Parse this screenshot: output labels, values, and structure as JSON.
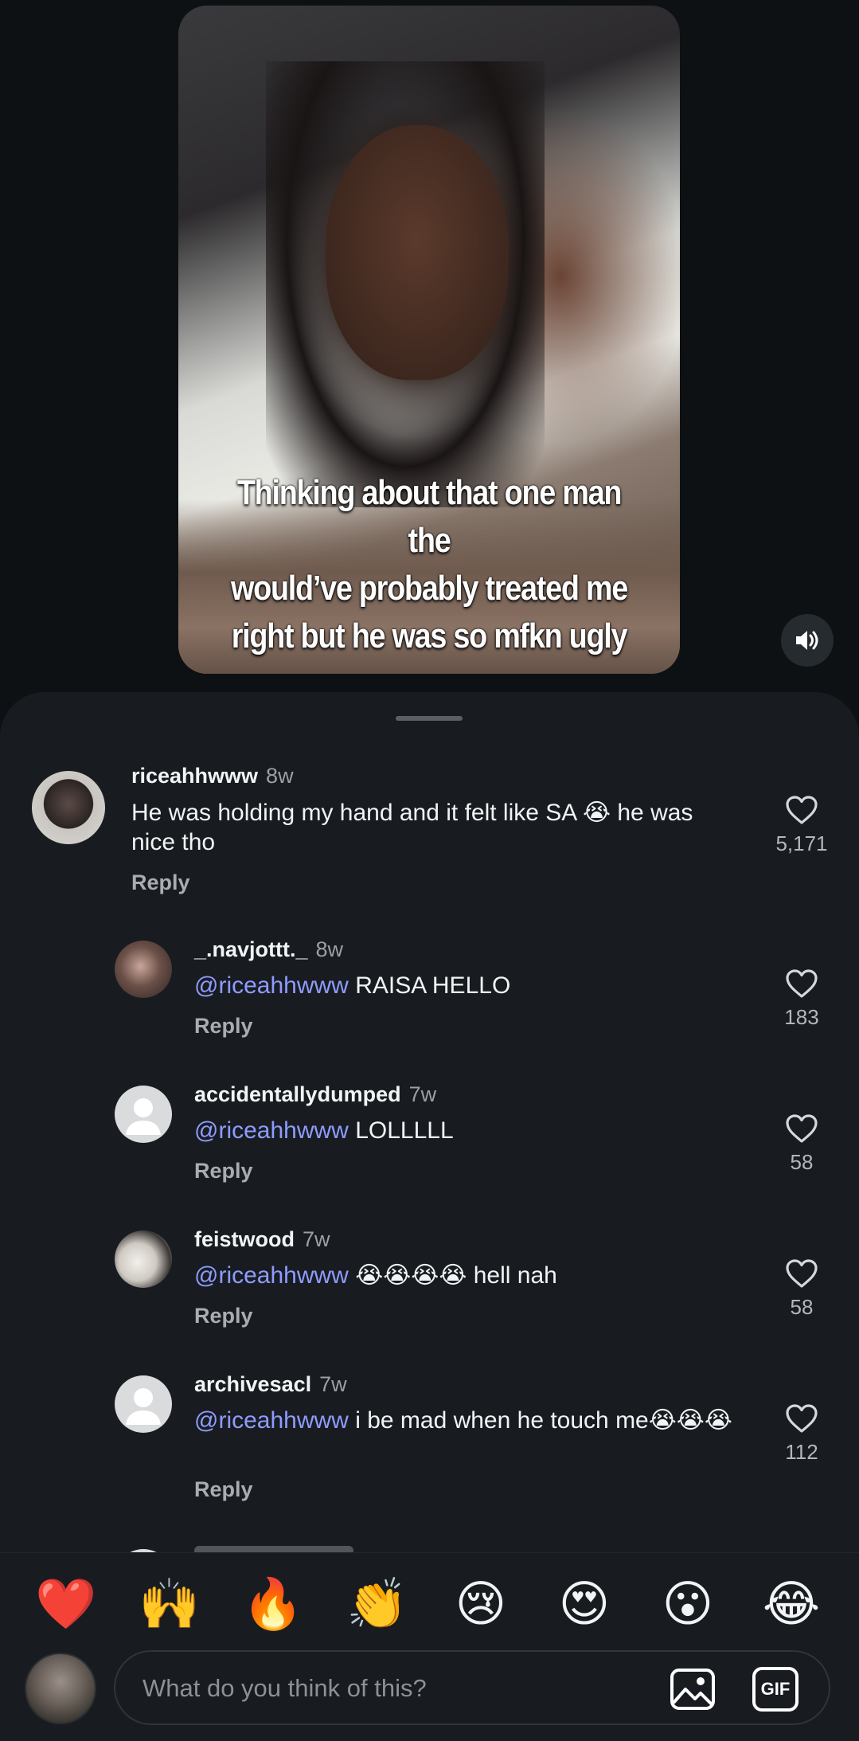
{
  "video": {
    "caption": "Thinking about that one man the\nwould’ve probably treated me\nright but he was so mfkn ugly",
    "volume_icon": "speaker-icon"
  },
  "comments": [
    {
      "username": "riceahhwww",
      "time": "8w",
      "mention": "",
      "text": "He was holding my hand and it felt like SA 😭 he was nice tho",
      "reply_label": "Reply",
      "likes": "5,171"
    },
    {
      "username": "_.navjottt._",
      "time": "8w",
      "mention": "@riceahhwww",
      "text": "RAISA HELLO",
      "reply_label": "Reply",
      "likes": "183"
    },
    {
      "username": "accidentallydumped",
      "time": "7w",
      "mention": "@riceahhwww",
      "text": "LOLLLLL",
      "reply_label": "Reply",
      "likes": "58"
    },
    {
      "username": "feistwood",
      "time": "7w",
      "mention": "@riceahhwww",
      "text": "😭😭😭😭 hell nah",
      "reply_label": "Reply",
      "likes": "58"
    },
    {
      "username": "archivesacl",
      "time": "7w",
      "mention": "@riceahhwww",
      "text": "i be mad when he touch me😭😭😭",
      "reply_label": "Reply",
      "likes": "112"
    }
  ],
  "reactions": [
    "❤️",
    "🙌",
    "🔥",
    "👏",
    "😢",
    "😍",
    "😮",
    "😂"
  ],
  "composer": {
    "placeholder": "What do you think of this?",
    "gif_label": "GIF"
  },
  "colors": {
    "background": "#0d1114",
    "sheet": "#181c20",
    "mention": "#8f9bff",
    "secondary_text": "#9aa0a6"
  }
}
